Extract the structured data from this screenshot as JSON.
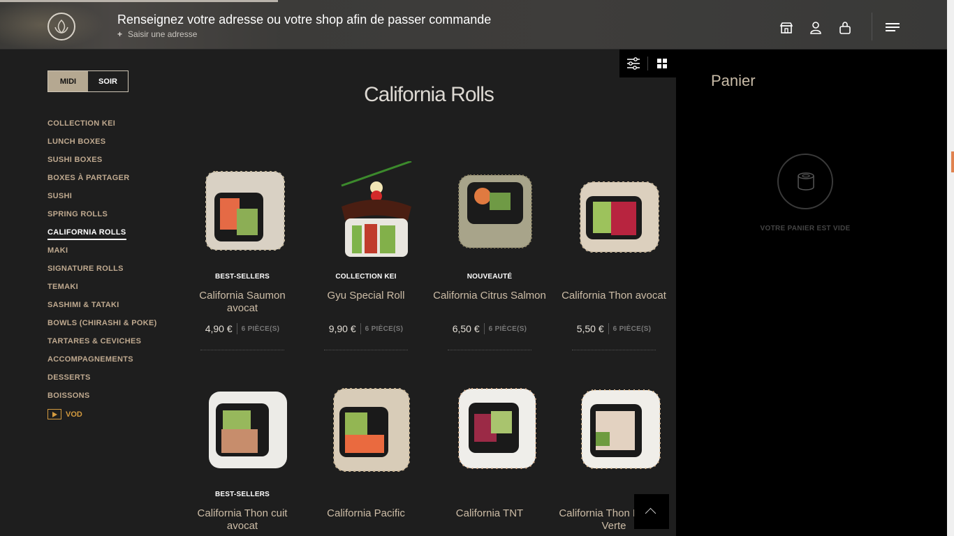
{
  "header": {
    "title": "Renseignez votre adresse ou votre shop afin de passer commande",
    "address_link": "Saisir une adresse",
    "icons": [
      "store-icon",
      "user-icon",
      "bag-icon",
      "menu-icon"
    ]
  },
  "service_toggle": {
    "midi": "MIDI",
    "soir": "SOIR",
    "selected": "MIDI"
  },
  "categories": [
    "COLLECTION KEI",
    "LUNCH BOXES",
    "SUSHI BOXES",
    "BOXES À PARTAGER",
    "SUSHI",
    "SPRING ROLLS",
    "CALIFORNIA ROLLS",
    "MAKI",
    "SIGNATURE ROLLS",
    "TEMAKI",
    "SASHIMI & TATAKI",
    "BOWLS (CHIRASHI & POKE)",
    "TARTARES & CEVICHES",
    "ACCOMPAGNEMENTS",
    "DESSERTS",
    "BOISSONS"
  ],
  "active_category": "CALIFORNIA ROLLS",
  "vod_label": "VOD",
  "section_title": "California Rolls",
  "products": [
    {
      "badge": "BEST-SELLERS",
      "name": "California Saumon avocat",
      "price": "4,90 €",
      "pieces": "6 PIÈCE(S)"
    },
    {
      "badge": "COLLECTION KEI",
      "name": "Gyu Special Roll",
      "price": "9,90 €",
      "pieces": "6 PIÈCE(S)"
    },
    {
      "badge": "NOUVEAUTÉ",
      "name": "California Citrus Salmon",
      "price": "6,50 €",
      "pieces": "6 PIÈCE(S)"
    },
    {
      "badge": "",
      "name": "California Thon avocat",
      "price": "5,50 €",
      "pieces": "6 PIÈCE(S)"
    },
    {
      "badge": "BEST-SELLERS",
      "name": "California Thon cuit avocat",
      "price": "",
      "pieces": ""
    },
    {
      "badge": "",
      "name": "California Pacific",
      "price": "",
      "pieces": ""
    },
    {
      "badge": "",
      "name": "California TNT",
      "price": "",
      "pieces": ""
    },
    {
      "badge": "",
      "name": "California Thon Pomme Verte",
      "price": "",
      "pieces": ""
    }
  ],
  "cart": {
    "title": "Panier",
    "empty_message": "VOTRE PANIER EST VIDE"
  },
  "colors": {
    "accent_gold": "#bfa98f",
    "toggle_active": "#b5a891",
    "vod_orange": "#d39a3f"
  }
}
